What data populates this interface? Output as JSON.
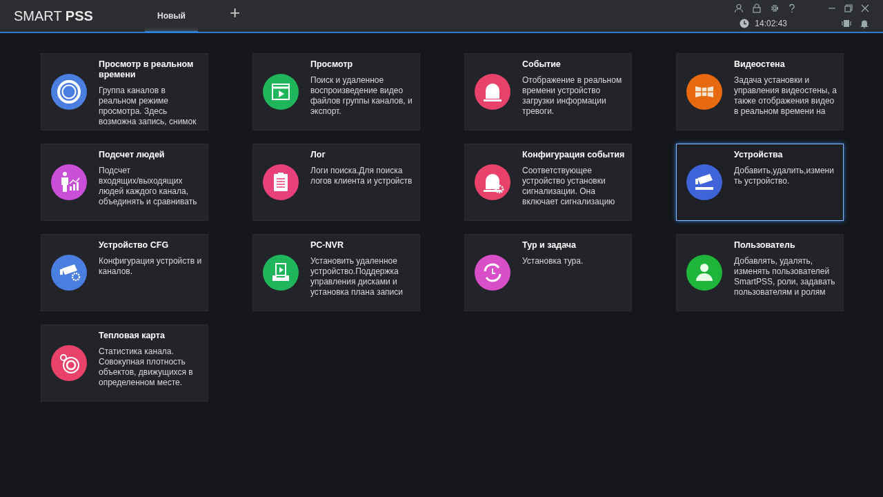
{
  "app": {
    "logo": "SMART **PSS**"
  },
  "tabs": [
    {
      "label": "Новый",
      "selected": true
    }
  ],
  "add_tab": "+",
  "status": {
    "time": "14:02:43"
  },
  "modules": [
    {
      "title": "Просмотр в реальном\nвремени",
      "description": "Группа каналов в\nреальном режиме\nпросмотра. Здесь\nвозможна запись, снимок",
      "kind": "live",
      "color": "#4a7fe0",
      "selected": false
    },
    {
      "title": "Просмотр",
      "description": "Поиск и удаленное\nвоспроизведение видео\nфайлов группы каналов, и\nэкспорт.",
      "kind": "playback",
      "color": "#1fb55a",
      "selected": false
    },
    {
      "title": "Событие",
      "description": "Отображение в реальном\nвремени устройство\nзагрузки информации\nтревоги.",
      "kind": "alarm",
      "color": "#e8426a",
      "selected": false
    },
    {
      "title": "Видеостена",
      "description": "Задача установки и\nуправления видеостены, а\nтакже отображения видео\nв реальном времени на",
      "kind": "wall",
      "color": "#e86a10",
      "selected": false
    },
    {
      "title": "Подсчет людей",
      "description": "Подсчет\nвходящих/выходящих\nлюдей каждого канала,\nобъединять и сравнивать",
      "kind": "people",
      "color": "#c94fd8",
      "selected": false
    },
    {
      "title": "Лог",
      "description": "Логи поиска.Для поиска\nлогов клиента и устройств",
      "kind": "log",
      "color": "#e8407a",
      "selected": false
    },
    {
      "title": "Конфигурация события",
      "description": "Соответствующее\nустройство установки\nсигнализации. Она\nвключает сигнализацию",
      "kind": "alarmcfg",
      "color": "#e8426a",
      "selected": false
    },
    {
      "title": "Устройства",
      "description": "Добавить,удалить,измени\nть устройство.",
      "kind": "device",
      "color": "#3f63d8",
      "selected": true
    },
    {
      "title": "Устройство CFG",
      "description": "Конфигурация устройств и\nканалов.",
      "kind": "devicecfg",
      "color": "#4a7fe0",
      "selected": false
    },
    {
      "title": "PC-NVR",
      "description": "Установить удаленное\nустройство.Поддержка\nуправления дисками и\nустановка плана записи",
      "kind": "nvr",
      "color": "#1fb55a",
      "selected": false
    },
    {
      "title": "Тур и задача",
      "description": "Установка тура.",
      "kind": "tour",
      "color": "#d84fc8",
      "selected": false
    },
    {
      "title": "Пользователь",
      "description": "Добавлять, удалять,\nизменять пользователей\nSmartPSS, роли, задавать\nпользователям и ролям",
      "kind": "user",
      "color": "#1fb53a",
      "selected": false
    },
    {
      "title": "Тепловая карта",
      "description": "Статистика канала.\nСовокупная плотность\nобъектов, движущихся в\nопределенном месте.",
      "kind": "heatmap",
      "color": "#e8426a",
      "selected": false
    }
  ]
}
